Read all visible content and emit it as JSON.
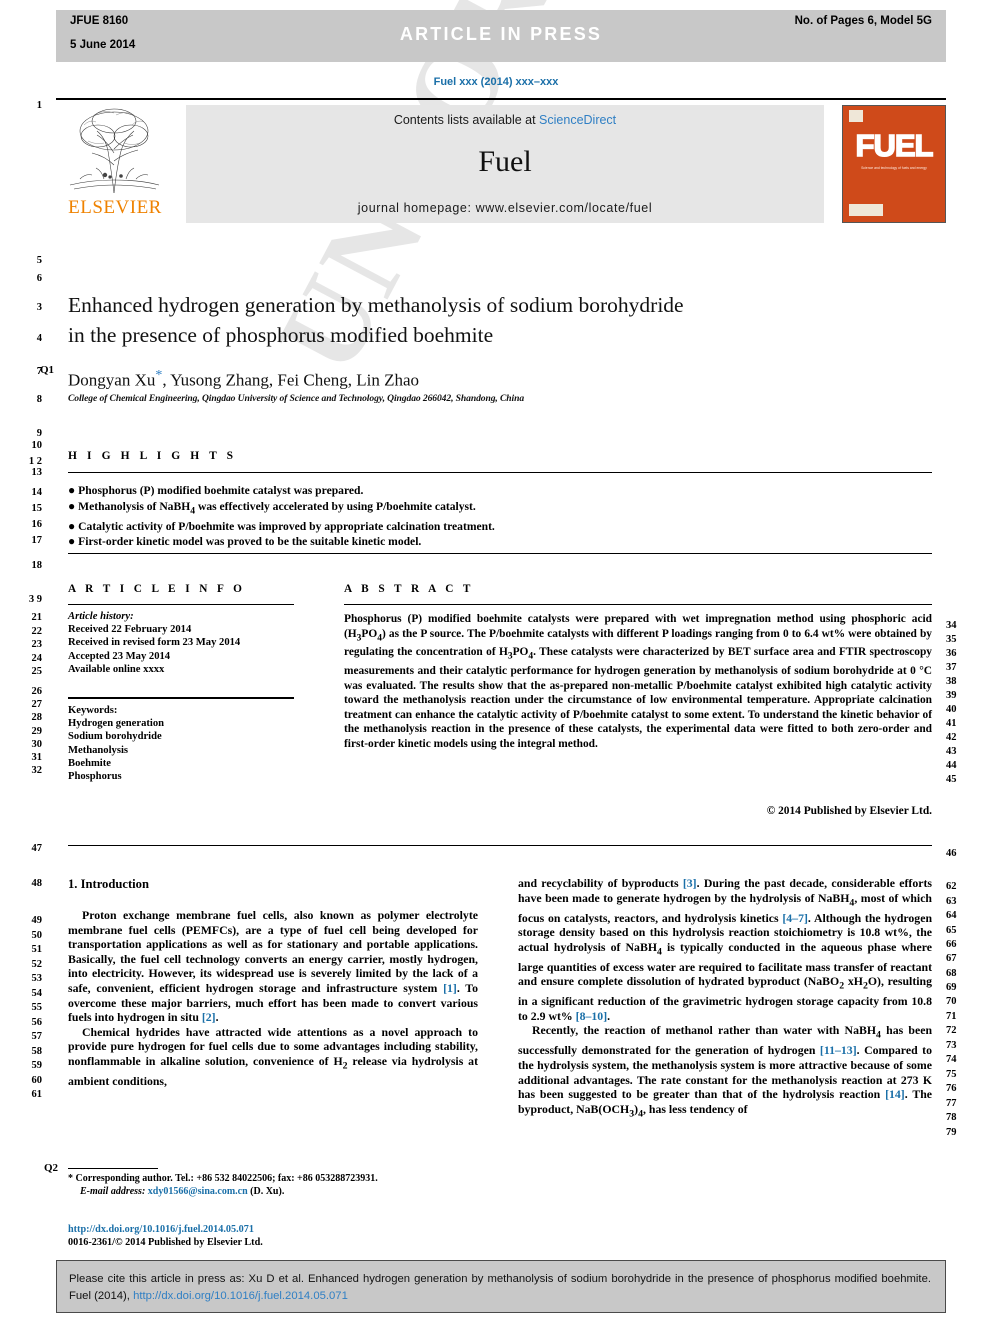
{
  "topbar": {
    "journal_id": "JFUE 8160",
    "date": "5 June 2014",
    "status": "ARTICLE  IN  PRESS",
    "pages_model": "No. of Pages 6, Model 5G",
    "bg_color": "#c8c8c8"
  },
  "running_head": "Fuel xxx (2014) xxx–xxx",
  "masthead": {
    "publisher": "ELSEVIER",
    "contents_prefix": "Contents lists available at ",
    "contents_link": "ScienceDirect",
    "journal_title": "Fuel",
    "homepage": "journal homepage: www.elsevier.com/locate/fuel",
    "cover_word": "FUEL",
    "cover_sub": "Science and technology of fuels and energy",
    "accent_orange": "#ef8200",
    "link_blue": "#2f7fc4"
  },
  "article": {
    "title_line1": "Enhanced hydrogen generation by methanolysis of sodium borohydride",
    "title_line2": "in the presence of phosphorus modified boehmite",
    "authors": "Dongyan Xu",
    "authors_rest": ", Yusong Zhang, Fei Cheng, Lin Zhao",
    "corresponding_mark": "*",
    "affiliation": "College of Chemical Engineering, Qingdao University of Science and Technology, Qingdao 266042, Shandong, China"
  },
  "highlights": {
    "heading": "H I G H L I G H T S",
    "items": [
      "Phosphorus (P) modified boehmite catalyst was prepared.",
      "Methanolysis of NaBH4 was effectively accelerated by using P/boehmite catalyst.",
      "Catalytic activity of P/boehmite was improved by appropriate calcination treatment.",
      "First-order kinetic model was proved to be the suitable kinetic model."
    ]
  },
  "article_info": {
    "heading": "A R T I C L E    I N F O",
    "history_label": "Article history:",
    "history": [
      "Received 22 February 2014",
      "Received in revised form 23 May 2014",
      "Accepted 23 May 2014",
      "Available online xxxx"
    ],
    "keywords_label": "Keywords:",
    "keywords": [
      "Hydrogen generation",
      "Sodium borohydride",
      "Methanolysis",
      "Boehmite",
      "Phosphorus"
    ]
  },
  "abstract": {
    "heading": "A B S T R A C T",
    "text": "Phosphorus (P) modified boehmite catalysts were prepared with wet impregnation method using phosphoric acid (H3PO4) as the P source. The P/boehmite catalysts with different P loadings ranging from 0 to 6.4 wt% were obtained by regulating the concentration of H3PO4. These catalysts were characterized by BET surface area and FTIR spectroscopy measurements and their catalytic performance for hydrogen generation by methanolysis of sodium borohydride at 0 °C was evaluated. The results show that the as-prepared non-metallic P/boehmite catalyst exhibited high catalytic activity toward the methanolysis reaction under the circumstance of low environmental temperature. Appropriate calcination treatment can enhance the catalytic activity of P/boehmite catalyst to some extent. To understand the kinetic behavior of the methanolysis reaction in the presence of these catalysts, the experimental data were fitted to both zero-order and first-order kinetic models using the integral method.",
    "copyright": "© 2014 Published by Elsevier Ltd."
  },
  "body": {
    "section_heading": "1. Introduction",
    "left_p1": "Proton exchange membrane fuel cells, also known as polymer electrolyte membrane fuel cells (PEMFCs), are a type of fuel cell being developed for transportation applications as well as for stationary and portable applications. Basically, the fuel cell technology converts an energy carrier, mostly hydrogen, into electricity. However, its widespread use is severely limited by the lack of a safe, convenient, efficient hydrogen storage and infrastructure system [1]. To overcome these major barriers, much effort has been made to convert various fuels into hydrogen in situ [2].",
    "left_p2": "Chemical hydrides have attracted wide attentions as a novel approach to provide pure hydrogen for fuel cells due to some advantages including stability, nonflammable in alkaline solution, convenience of H2 release via hydrolysis at ambient conditions,",
    "right_p1": "and recyclability of byproducts [3]. During the past decade, considerable efforts have been made to generate hydrogen by the hydrolysis of NaBH4, most of which focus on catalysts, reactors, and hydrolysis kinetics [4–7]. Although the hydrogen storage density based on this hydrolysis reaction stoichiometry is 10.8 wt%, the actual hydrolysis of NaBH4 is typically conducted in the aqueous phase where large quantities of excess water are required to facilitate mass transfer of reactant and ensure complete dissolution of hydrated byproduct (NaBO2 xH2O), resulting in a significant reduction of the gravimetric hydrogen storage capacity from 10.8 to 2.9 wt% [8–10].",
    "right_p2": "Recently, the reaction of methanol rather than water with NaBH4 has been successfully demonstrated for the generation of hydrogen [11–13]. Compared to the hydrolysis system, the methanolysis system is more attractive because of some additional advantages. The rate constant for the methanolysis reaction at 273 K has been suggested to be greater than that of the hydrolysis reaction [14]. The byproduct, NaB(OCH3)4, has less tendency of"
  },
  "footnote": {
    "corresponding": "* Corresponding author. Tel.: +86 532 84022506; fax: +86 053288723931.",
    "email_label": "E-mail address:",
    "email": "xdy01566@sina.com.cn",
    "email_suffix": "(D. Xu).",
    "doi": "http://dx.doi.org/10.1016/j.fuel.2014.05.071",
    "issn_line": "0016-2361/© 2014 Published by Elsevier Ltd."
  },
  "cite_box": {
    "text_before": "Please cite this article in press as: Xu D et al. Enhanced hydrogen generation by methanolysis of sodium borohydride in the presence of phosphorus modified boehmite. Fuel (2014), ",
    "link": "http://dx.doi.org/10.1016/j.fuel.2014.05.071"
  },
  "watermark": "UNCORRECTED PROOF",
  "query_tags": {
    "q1": "Q1",
    "q2": "Q2"
  },
  "line_numbers": {
    "left": [
      "1",
      "5",
      "6",
      "3",
      "4",
      "7",
      "8",
      "9",
      "10",
      "1 2",
      "13",
      "14",
      "15",
      "16",
      "17",
      "18",
      "3 9",
      "21",
      "22",
      "23",
      "24",
      "25",
      "26",
      "27",
      "28",
      "29",
      "30",
      "31",
      "32",
      "47",
      "48",
      "49",
      "50",
      "51",
      "52",
      "53",
      "54",
      "55",
      "56",
      "57",
      "58",
      "59",
      "60",
      "61"
    ],
    "right": [
      "34",
      "35",
      "36",
      "37",
      "38",
      "39",
      "40",
      "41",
      "42",
      "43",
      "44",
      "45",
      "46",
      "62",
      "63",
      "64",
      "65",
      "66",
      "67",
      "68",
      "69",
      "70",
      "71",
      "72",
      "73",
      "74",
      "75",
      "76",
      "77",
      "78",
      "79"
    ]
  }
}
